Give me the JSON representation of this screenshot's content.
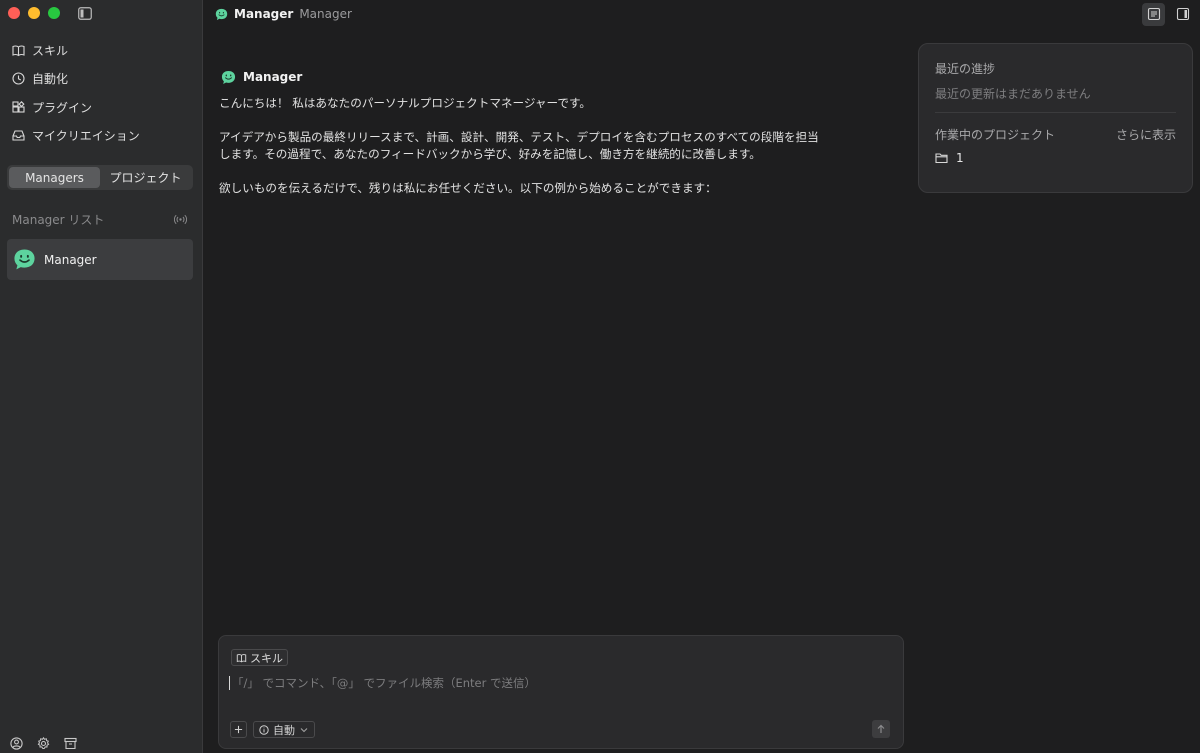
{
  "sidebar": {
    "nav": [
      {
        "label": "スキル",
        "icon": "book-icon"
      },
      {
        "label": "自動化",
        "icon": "clock-icon"
      },
      {
        "label": "プラグイン",
        "icon": "puzzle-icon"
      },
      {
        "label": "マイクリエイション",
        "icon": "inbox-icon"
      }
    ],
    "segments": [
      "Managers",
      "プロジェクト"
    ],
    "active_segment": "Managers",
    "manager_list_title": "Manager リスト",
    "managers": [
      {
        "name": "Manager"
      }
    ]
  },
  "topbar": {
    "title": "Manager",
    "subtitle": "Manager"
  },
  "chat": {
    "messages": [
      {
        "author": "Manager",
        "paragraphs": [
          "こんにちは！ 私はあなたのパーソナルプロジェクトマネージャーです。",
          "アイデアから製品の最終リリースまで、計画、設計、開発、テスト、デプロイを含むプロセスのすべての段階を担当します。その過程で、あなたのフィードバックから学び、好みを記憶し、働き方を継続的に改善します。",
          "欲しいものを伝えるだけで、残りは私にお任せください。以下の例から始めることができます："
        ]
      }
    ]
  },
  "right_panel": {
    "progress_title": "最近の進捗",
    "progress_empty": "最近の更新はまだありません",
    "projects_title": "作業中のプロジェクト",
    "show_more": "さらに表示",
    "projects": [
      {
        "name": "1"
      }
    ]
  },
  "composer": {
    "skill_chip": "スキル",
    "placeholder": "「/」 でコマンド、「@」 でファイル検索（Enter で送信）",
    "mode_label": "自動"
  },
  "colors": {
    "accent_green": "#5dd39e",
    "background": "#1e1e1f",
    "sidebar": "#2b2c2d"
  }
}
